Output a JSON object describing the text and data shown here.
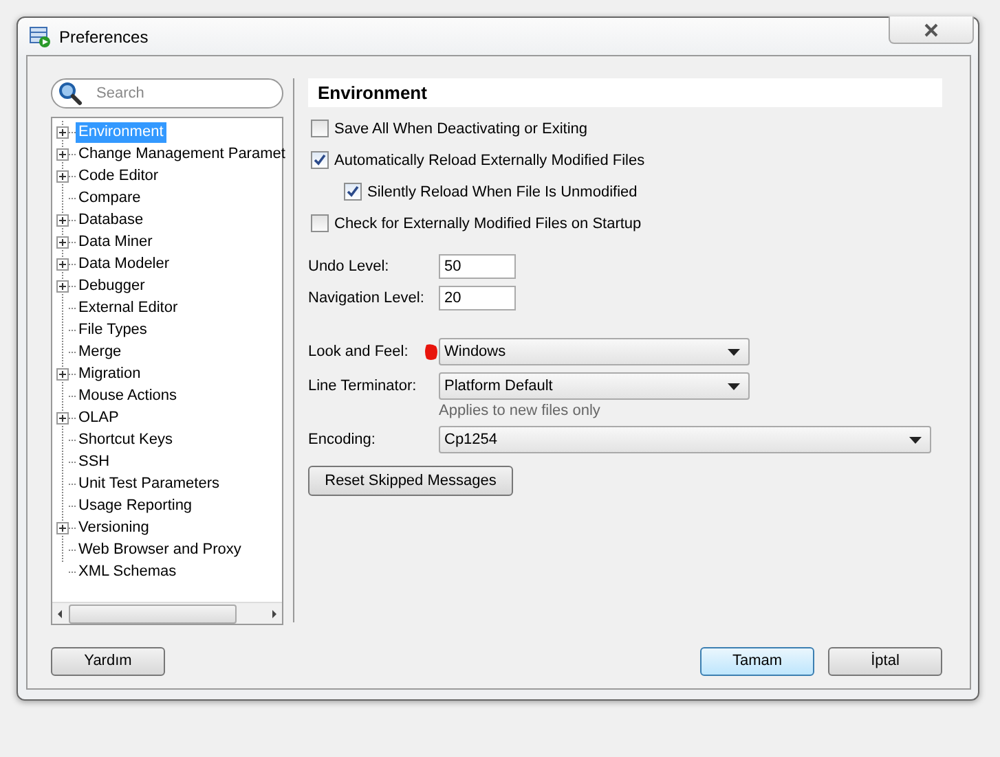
{
  "window": {
    "title": "Preferences"
  },
  "search": {
    "placeholder": "Search"
  },
  "tree": {
    "items": [
      {
        "label": "Environment",
        "expandable": true,
        "selected": true
      },
      {
        "label": "Change Management Paramet",
        "expandable": true,
        "selected": false
      },
      {
        "label": "Code Editor",
        "expandable": true,
        "selected": false
      },
      {
        "label": "Compare",
        "expandable": false,
        "selected": false
      },
      {
        "label": "Database",
        "expandable": true,
        "selected": false
      },
      {
        "label": "Data Miner",
        "expandable": true,
        "selected": false
      },
      {
        "label": "Data Modeler",
        "expandable": true,
        "selected": false
      },
      {
        "label": "Debugger",
        "expandable": true,
        "selected": false
      },
      {
        "label": "External Editor",
        "expandable": false,
        "selected": false
      },
      {
        "label": "File Types",
        "expandable": false,
        "selected": false
      },
      {
        "label": "Merge",
        "expandable": false,
        "selected": false
      },
      {
        "label": "Migration",
        "expandable": true,
        "selected": false
      },
      {
        "label": "Mouse Actions",
        "expandable": false,
        "selected": false
      },
      {
        "label": "OLAP",
        "expandable": true,
        "selected": false
      },
      {
        "label": "Shortcut Keys",
        "expandable": false,
        "selected": false
      },
      {
        "label": "SSH",
        "expandable": false,
        "selected": false
      },
      {
        "label": "Unit Test Parameters",
        "expandable": false,
        "selected": false
      },
      {
        "label": "Usage Reporting",
        "expandable": false,
        "selected": false
      },
      {
        "label": "Versioning",
        "expandable": true,
        "selected": false
      },
      {
        "label": "Web Browser and Proxy",
        "expandable": false,
        "selected": false
      },
      {
        "label": "XML Schemas",
        "expandable": false,
        "selected": false
      }
    ]
  },
  "panel": {
    "title": "Environment",
    "checkboxes": [
      {
        "label": "Save All When Deactivating or Exiting",
        "checked": false
      },
      {
        "label": "Automatically Reload Externally Modified Files",
        "checked": true,
        "children": [
          {
            "label": "Silently Reload When File Is Unmodified",
            "checked": true
          }
        ]
      },
      {
        "label": "Check for Externally Modified Files on Startup",
        "checked": false
      }
    ],
    "fields": [
      {
        "label": "Undo Level:",
        "value": "50"
      },
      {
        "label": "Navigation Level:",
        "value": "20"
      }
    ],
    "dropdowns": [
      {
        "label": "Look and Feel:",
        "value": "Windows",
        "kind": "compact",
        "marked": true
      },
      {
        "label": "Line Terminator:",
        "value": "Platform Default",
        "kind": "compact",
        "hint": "Applies to new files only"
      },
      {
        "label": "Encoding:",
        "value": "Cp1254",
        "kind": "full"
      }
    ],
    "reset_button": "Reset Skipped Messages"
  },
  "buttons": [
    {
      "label": "Yardım",
      "kind": "help",
      "default": false
    },
    {
      "label": "Tamam",
      "kind": "action",
      "default": true
    },
    {
      "label": "İptal",
      "kind": "action",
      "default": false
    }
  ]
}
